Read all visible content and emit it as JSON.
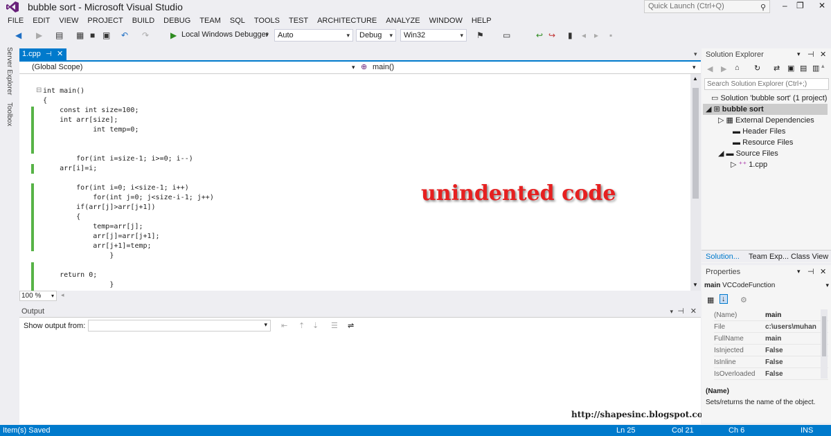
{
  "window": {
    "title": "bubble sort - Microsoft Visual Studio",
    "quick_launch_placeholder": "Quick Launch (Ctrl+Q)"
  },
  "menu": [
    "FILE",
    "EDIT",
    "VIEW",
    "PROJECT",
    "BUILD",
    "DEBUG",
    "TEAM",
    "SQL",
    "TOOLS",
    "TEST",
    "ARCHITECTURE",
    "ANALYZE",
    "WINDOW",
    "HELP"
  ],
  "toolbar": {
    "debugger_label": "Local Windows Debugger",
    "auto_value": "Auto",
    "config_value": "Debug",
    "platform_value": "Win32"
  },
  "side_tabs": {
    "server_explorer": "Server Explorer",
    "toolbox": "Toolbox"
  },
  "editor": {
    "tab_name": "1.cpp",
    "scope_left": "(Global Scope)",
    "scope_right": "main()",
    "zoom": "100 %",
    "code": [
      "int main()",
      "{",
      "    const int size=100;",
      "    int arr[size];",
      "            int temp=0;",
      "",
      "",
      "        for(int i=size-1; i>=0; i--)",
      "    arr[i]=i;",
      "",
      "        for(int i=0; i<size-1; i++)",
      "            for(int j=0; j<size-i-1; j++)",
      "        if(arr[j]>arr[j+1])",
      "        {",
      "            temp=arr[j];",
      "            arr[j]=arr[j+1];",
      "            arr[j+1]=temp;",
      "                }",
      "",
      "    return 0;",
      "                }"
    ],
    "annotation": "unindented code"
  },
  "output": {
    "title": "Output",
    "show_output_from": "Show output from:"
  },
  "solution_explorer": {
    "title": "Solution Explorer",
    "search_placeholder": "Search Solution Explorer (Ctrl+;)",
    "tree": [
      "Solution 'bubble sort' (1 project)",
      "bubble sort",
      "External Dependencies",
      "Header Files",
      "Resource Files",
      "Source Files",
      "1.cpp"
    ],
    "tabs": [
      "Solution...",
      "Team Exp...",
      "Class View"
    ]
  },
  "properties": {
    "title": "Properties",
    "object": "main",
    "object_type": "VCCodeFunction",
    "rows": [
      {
        "name": "(Name)",
        "value": "main"
      },
      {
        "name": "File",
        "value": "c:\\users\\muhan"
      },
      {
        "name": "FullName",
        "value": "main"
      },
      {
        "name": "IsInjected",
        "value": "False"
      },
      {
        "name": "IsInline",
        "value": "False"
      },
      {
        "name": "IsOverloaded",
        "value": "False"
      }
    ],
    "desc_title": "(Name)",
    "desc_text": "Sets/returns the name of the object."
  },
  "watermark_url": "http://shapesinc.blogspot.com",
  "status": {
    "message": "Item(s) Saved",
    "line": "Ln 25",
    "col": "Col 21",
    "ch": "Ch 6",
    "mode": "INS"
  }
}
